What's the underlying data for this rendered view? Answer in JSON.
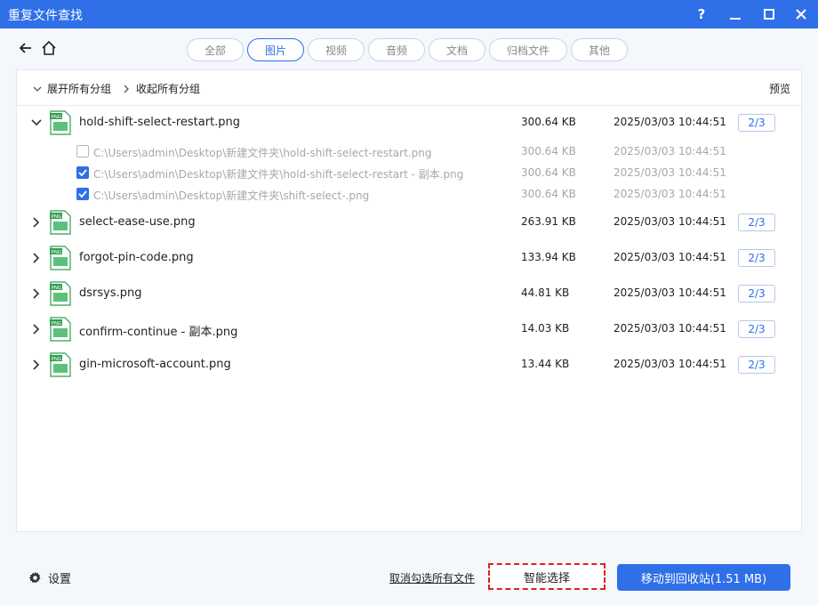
{
  "window": {
    "title": "重复文件查找",
    "help_label": "?"
  },
  "tabs": [
    {
      "label": "全部",
      "active": false
    },
    {
      "label": "图片",
      "active": true
    },
    {
      "label": "视频",
      "active": false
    },
    {
      "label": "音频",
      "active": false
    },
    {
      "label": "文档",
      "active": false
    },
    {
      "label": "归档文件",
      "active": false
    },
    {
      "label": "其他",
      "active": false
    }
  ],
  "panel": {
    "expand_all": "展开所有分组",
    "collapse_all": "收起所有分组",
    "preview": "预览"
  },
  "file_icon_label": "PNG",
  "groups": [
    {
      "name": "hold-shift-select-restart.png",
      "size": "300.64 KB",
      "date": "2025/03/03 10:44:51",
      "count": "2/3",
      "expanded": true,
      "items": [
        {
          "path": "C:\\Users\\admin\\Desktop\\新建文件夹\\hold-shift-select-restart.png",
          "size": "300.64 KB",
          "date": "2025/03/03 10:44:51",
          "checked": false
        },
        {
          "path": "C:\\Users\\admin\\Desktop\\新建文件夹\\hold-shift-select-restart - 副本.png",
          "size": "300.64 KB",
          "date": "2025/03/03 10:44:51",
          "checked": true
        },
        {
          "path": "C:\\Users\\admin\\Desktop\\新建文件夹\\shift-select-.png",
          "size": "300.64 KB",
          "date": "2025/03/03 10:44:51",
          "checked": true
        }
      ]
    },
    {
      "name": "select-ease-use.png",
      "size": "263.91 KB",
      "date": "2025/03/03 10:44:51",
      "count": "2/3",
      "expanded": false
    },
    {
      "name": "forgot-pin-code.png",
      "size": "133.94 KB",
      "date": "2025/03/03 10:44:51",
      "count": "2/3",
      "expanded": false
    },
    {
      "name": "dsrsys.png",
      "size": "44.81 KB",
      "date": "2025/03/03 10:44:51",
      "count": "2/3",
      "expanded": false
    },
    {
      "name": "confirm-continue - 副本.png",
      "size": "14.03 KB",
      "date": "2025/03/03 10:44:51",
      "count": "2/3",
      "expanded": false
    },
    {
      "name": "gin-microsoft-account.png",
      "size": "13.44 KB",
      "date": "2025/03/03 10:44:51",
      "count": "2/3",
      "expanded": false
    }
  ],
  "footer": {
    "settings": "设置",
    "deselect_all": "取消勾选所有文件",
    "smart_select": "智能选择",
    "move_to_recycle": "移动到回收站(1.51 MB)"
  },
  "colors": {
    "accent": "#2f6fe8",
    "highlight_border": "#e02020",
    "file_icon_green": "#2e9e4f"
  }
}
